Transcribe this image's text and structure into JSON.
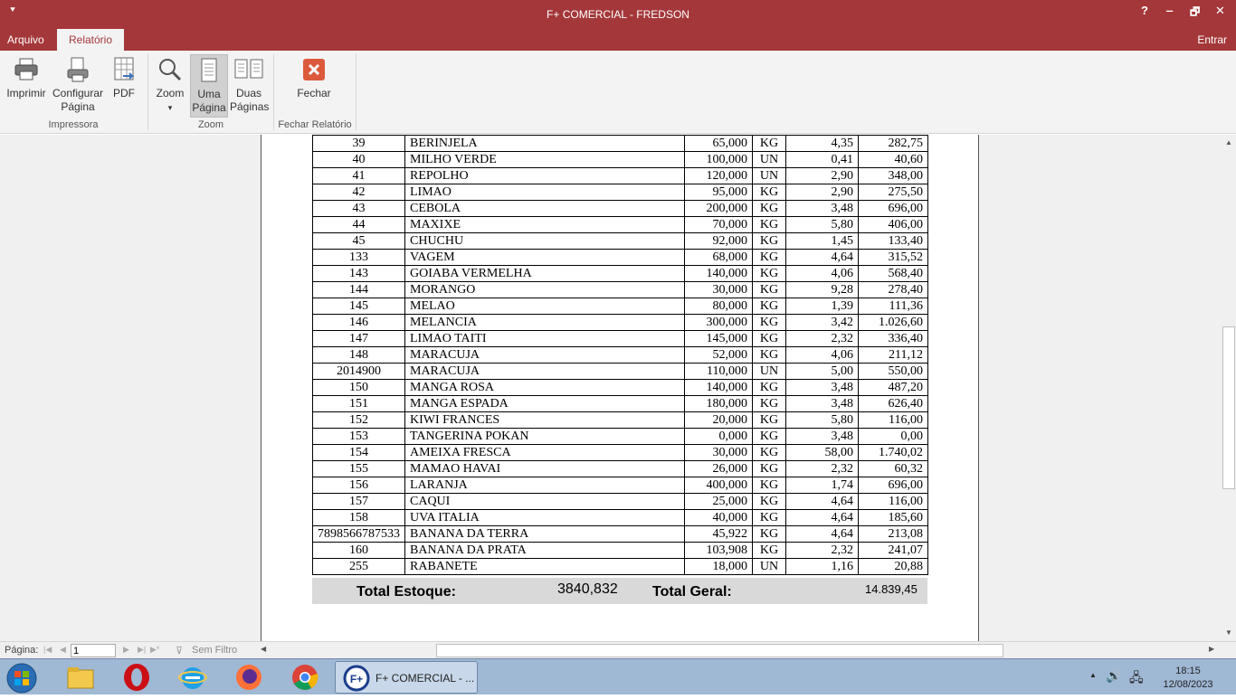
{
  "window": {
    "title": "F+ COMERCIAL - FREDSON",
    "quick_access": "⯆",
    "help": "?",
    "minimize": "‒",
    "restore": "🗗",
    "close": "✕"
  },
  "tabs": [
    {
      "label": "Arquivo"
    },
    {
      "label": "Relatório"
    }
  ],
  "signin": "Entrar",
  "ribbon": {
    "print": "Imprimir",
    "page_setup_1": "Configurar",
    "page_setup_2": "Página",
    "pdf": "PDF",
    "zoom": "Zoom",
    "zoom_arrow": "▾",
    "one_page_1": "Uma",
    "one_page_2": "Página",
    "two_pages_1": "Duas",
    "two_pages_2": "Páginas",
    "close": "Fechar",
    "groups": {
      "printer": "Impressora",
      "zoom": "Zoom",
      "close_report": "Fechar Relatório"
    }
  },
  "report": {
    "rows": [
      [
        "39",
        "BERINJELA",
        "65,000",
        "KG",
        "4,35",
        "282,75"
      ],
      [
        "40",
        "MILHO VERDE",
        "100,000",
        "UN",
        "0,41",
        "40,60"
      ],
      [
        "41",
        "REPOLHO",
        "120,000",
        "UN",
        "2,90",
        "348,00"
      ],
      [
        "42",
        "LIMAO",
        "95,000",
        "KG",
        "2,90",
        "275,50"
      ],
      [
        "43",
        "CEBOLA",
        "200,000",
        "KG",
        "3,48",
        "696,00"
      ],
      [
        "44",
        "MAXIXE",
        "70,000",
        "KG",
        "5,80",
        "406,00"
      ],
      [
        "45",
        "CHUCHU",
        "92,000",
        "KG",
        "1,45",
        "133,40"
      ],
      [
        "133",
        "VAGEM",
        "68,000",
        "KG",
        "4,64",
        "315,52"
      ],
      [
        "143",
        "GOIABA VERMELHA",
        "140,000",
        "KG",
        "4,06",
        "568,40"
      ],
      [
        "144",
        "MORANGO",
        "30,000",
        "KG",
        "9,28",
        "278,40"
      ],
      [
        "145",
        "MELAO",
        "80,000",
        "KG",
        "1,39",
        "111,36"
      ],
      [
        "146",
        "MELANCIA",
        "300,000",
        "KG",
        "3,42",
        "1.026,60"
      ],
      [
        "147",
        "LIMAO TAITI",
        "145,000",
        "KG",
        "2,32",
        "336,40"
      ],
      [
        "148",
        "MARACUJA",
        "52,000",
        "KG",
        "4,06",
        "211,12"
      ],
      [
        "2014900",
        "MARACUJA",
        "110,000",
        "UN",
        "5,00",
        "550,00"
      ],
      [
        "150",
        "MANGA ROSA",
        "140,000",
        "KG",
        "3,48",
        "487,20"
      ],
      [
        "151",
        "MANGA ESPADA",
        "180,000",
        "KG",
        "3,48",
        "626,40"
      ],
      [
        "152",
        "KIWI FRANCES",
        "20,000",
        "KG",
        "5,80",
        "116,00"
      ],
      [
        "153",
        "TANGERINA POKAN",
        "0,000",
        "KG",
        "3,48",
        "0,00"
      ],
      [
        "154",
        "AMEIXA FRESCA",
        "30,000",
        "KG",
        "58,00",
        "1.740,02"
      ],
      [
        "155",
        "MAMAO HAVAI",
        "26,000",
        "KG",
        "2,32",
        "60,32"
      ],
      [
        "156",
        "LARANJA",
        "400,000",
        "KG",
        "1,74",
        "696,00"
      ],
      [
        "157",
        "CAQUI",
        "25,000",
        "KG",
        "4,64",
        "116,00"
      ],
      [
        "158",
        "UVA ITALIA",
        "40,000",
        "KG",
        "4,64",
        "185,60"
      ],
      [
        "7898566787533",
        "BANANA DA TERRA",
        "45,922",
        "KG",
        "4,64",
        "213,08"
      ],
      [
        "160",
        "BANANA DA PRATA",
        "103,908",
        "KG",
        "2,32",
        "241,07"
      ],
      [
        "255",
        "RABANETE",
        "18,000",
        "UN",
        "1,16",
        "20,88"
      ]
    ],
    "totals": {
      "stock_label": "Total Estoque:",
      "stock_value": "3840,832",
      "general_label": "Total Geral:",
      "general_value": "14.839,45"
    }
  },
  "status": {
    "page_label": "Página:",
    "page_value": "1",
    "filter": "Sem Filtro"
  },
  "taskbar": {
    "task_label": "F+ COMERCIAL - ...",
    "time": "18:15",
    "date": "12/08/2023"
  }
}
